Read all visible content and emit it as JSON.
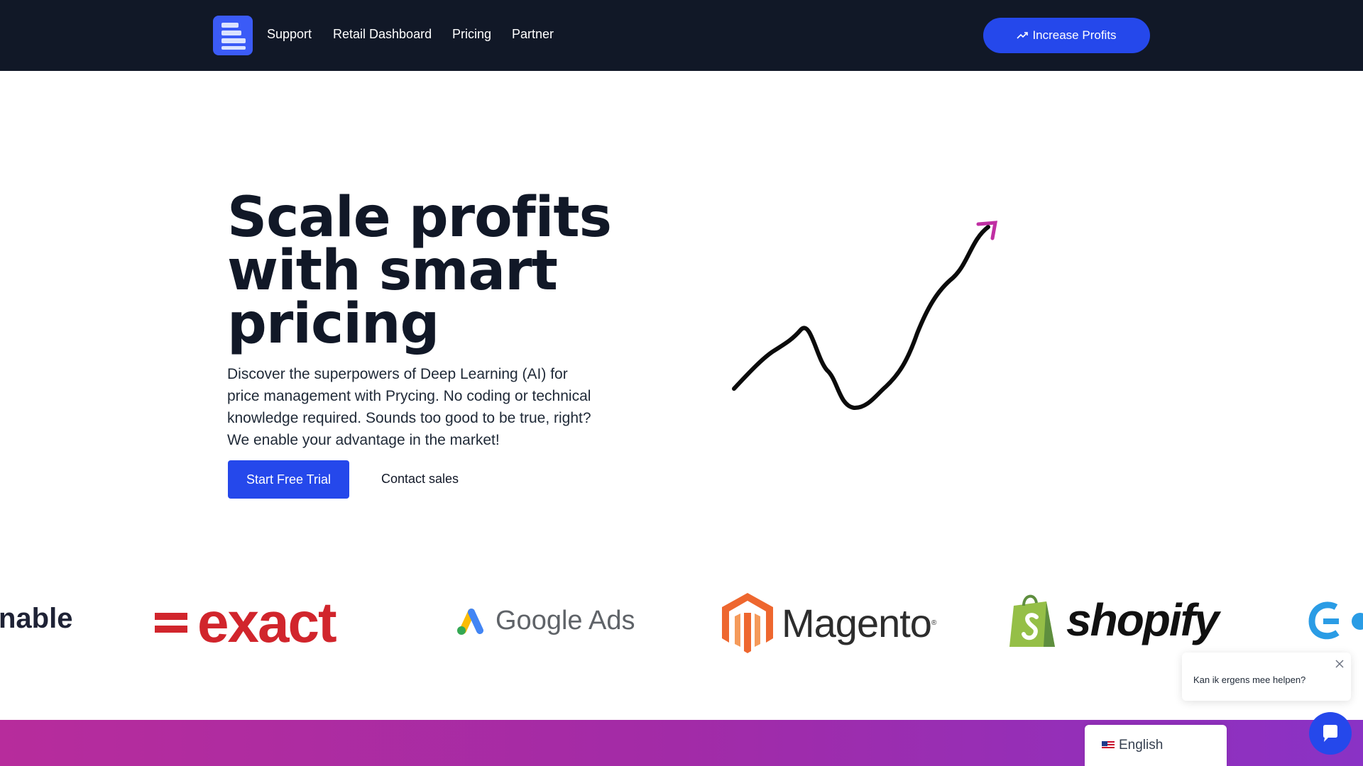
{
  "nav": {
    "links": [
      "Support",
      "Retail Dashboard",
      "Pricing",
      "Partner"
    ],
    "cta_label": "Increase Profits"
  },
  "hero": {
    "title": "Scale profits with smart pricing",
    "description": "Discover the superpowers of Deep Learning (AI) for price management with Prycing. No coding or technical knowledge required. Sounds too good to be true, right? We enable your advantage in the market!",
    "primary_button": "Start Free Trial",
    "secondary_button": "Contact sales"
  },
  "logos": {
    "nable": "nable",
    "exact": "exact",
    "google_ads": "Google Ads",
    "magento": "Magento",
    "shopify": "shopify"
  },
  "chat": {
    "message": "Kan ik ergens mee helpen?"
  },
  "language": {
    "selected": "English"
  },
  "colors": {
    "nav_bg": "#111827",
    "primary": "#2548eb",
    "band_start": "#b72c9c",
    "band_end": "#8a32c5"
  }
}
